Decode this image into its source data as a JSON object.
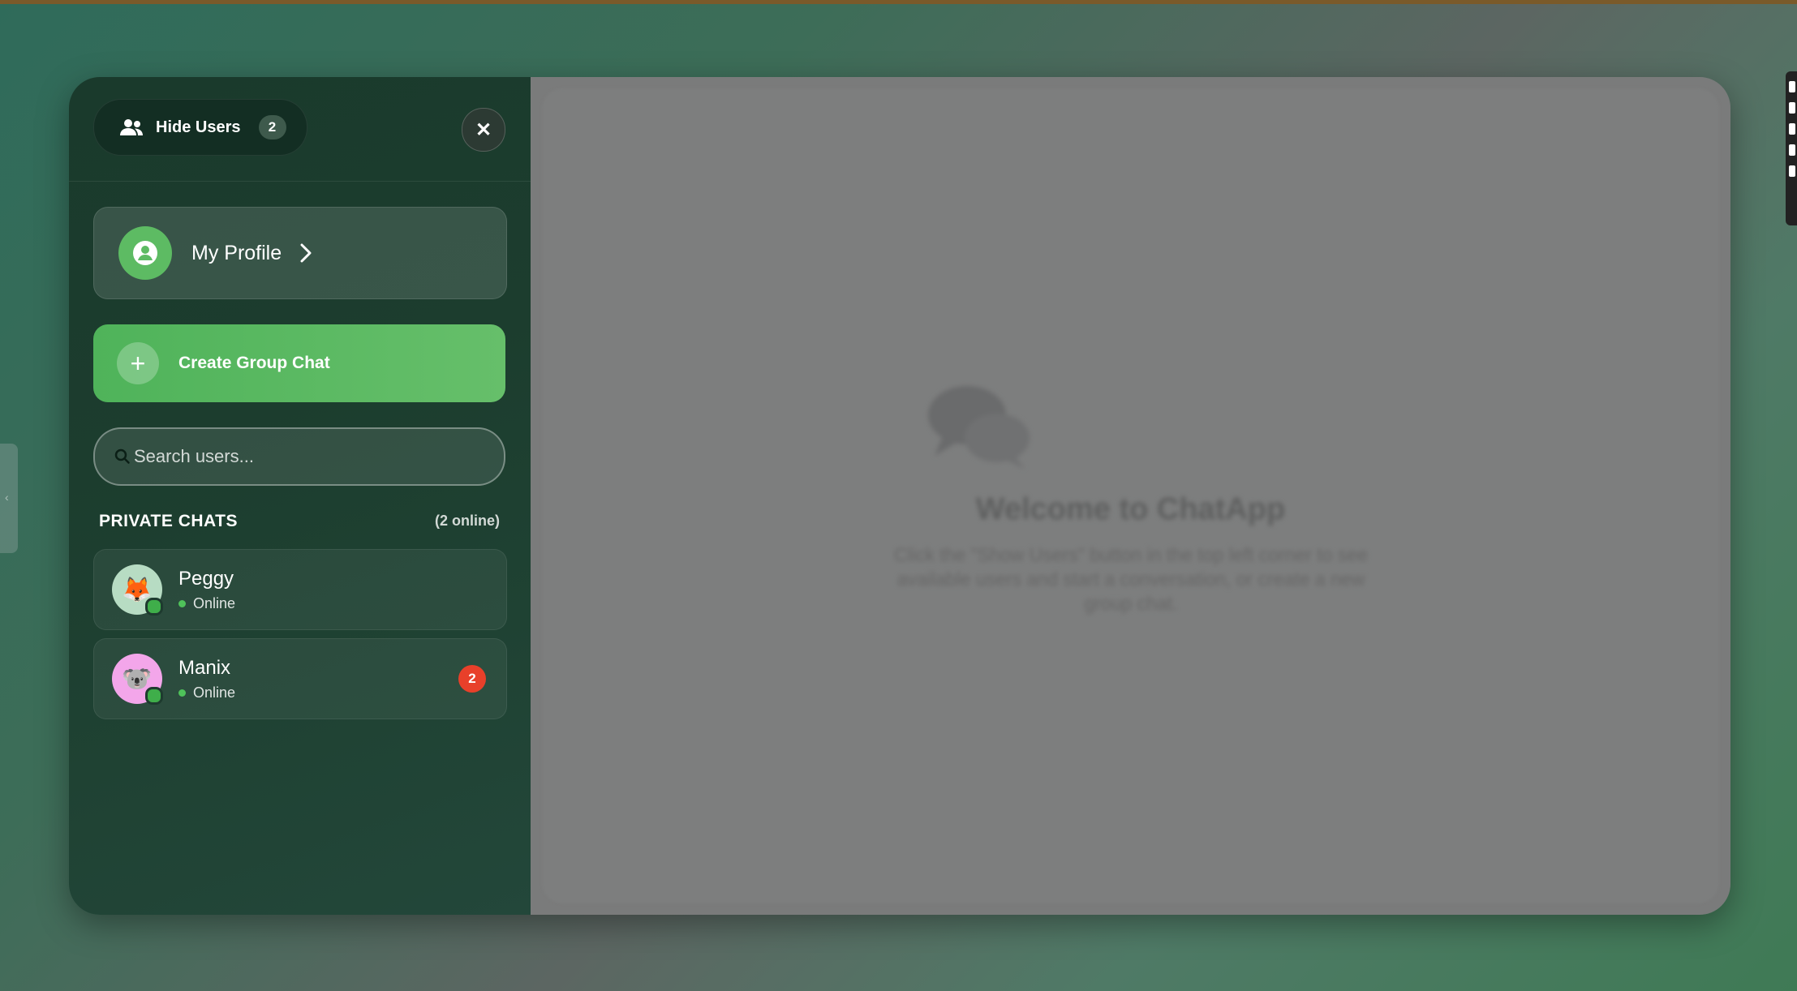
{
  "header": {
    "hide_users_label": "Hide Users",
    "user_count": "2",
    "close_icon": "close-icon",
    "users_icon": "users-icon"
  },
  "profile": {
    "label": "My Profile",
    "icon": "user-circle-icon"
  },
  "create_group": {
    "label": "Create Group Chat",
    "icon": "plus-icon"
  },
  "search": {
    "placeholder": "Search users...",
    "value": ""
  },
  "private_chats": {
    "title": "PRIVATE CHATS",
    "online_count": "(2 online)",
    "items": [
      {
        "name": "Peggy",
        "status": "Online",
        "avatar": "🦊",
        "avatar_bg": "#b7dcc3",
        "unread": ""
      },
      {
        "name": "Manix",
        "status": "Online",
        "avatar": "🐨",
        "avatar_bg": "#f3a6ea",
        "unread": "2"
      }
    ]
  },
  "welcome": {
    "title": "Welcome to ChatApp",
    "text": "Click the \"Show Users\" button in the top left corner to see available users and start a conversation, or create a new group chat."
  },
  "colors": {
    "accent_green": "#5dbb63",
    "sidebar_bg": "#1c3d2e",
    "unread_red": "#e8402a"
  }
}
